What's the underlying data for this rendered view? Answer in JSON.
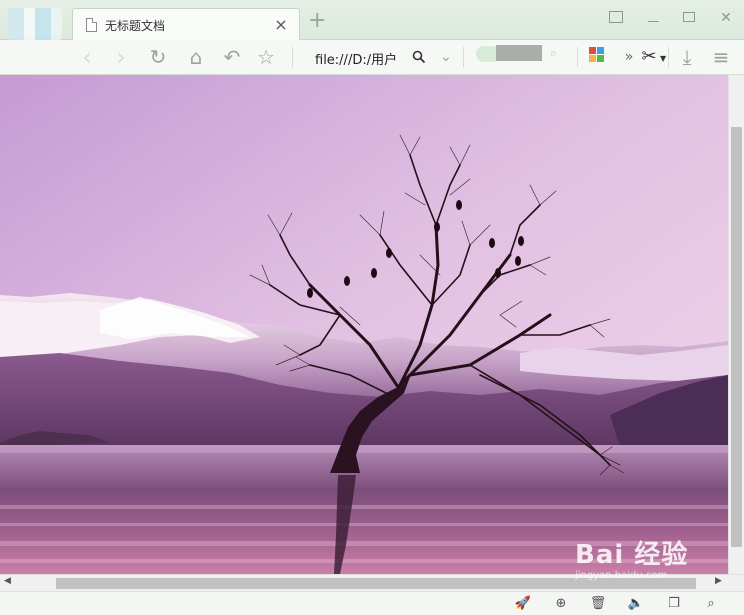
{
  "tab": {
    "title": "无标题文档",
    "close": "×",
    "new": "+"
  },
  "window": {
    "minimize": "",
    "maximize": "",
    "close": "✕"
  },
  "toolbar": {
    "back": "‹",
    "forward": "›",
    "reload": "↻",
    "home": "⌂",
    "undo": "↶",
    "star": "☆",
    "address": "file:///D:/用户",
    "zoom": "🔍",
    "dropdown": "⌄",
    "more": "»",
    "scissors": "✂",
    "download": "⤓",
    "menu": "≡"
  },
  "statusbar": {
    "rocket": "🚀",
    "plus_circle": "⊕",
    "trash": "🗑",
    "speaker": "🔈",
    "window": "❐",
    "search": "⌕"
  },
  "watermark": {
    "brand": "Bai 经验",
    "sub": "jingyan.baidu.com"
  },
  "colors": {
    "accent": "#9aa59a",
    "sky": "#e6bde4",
    "water": "#8e5d8a"
  }
}
